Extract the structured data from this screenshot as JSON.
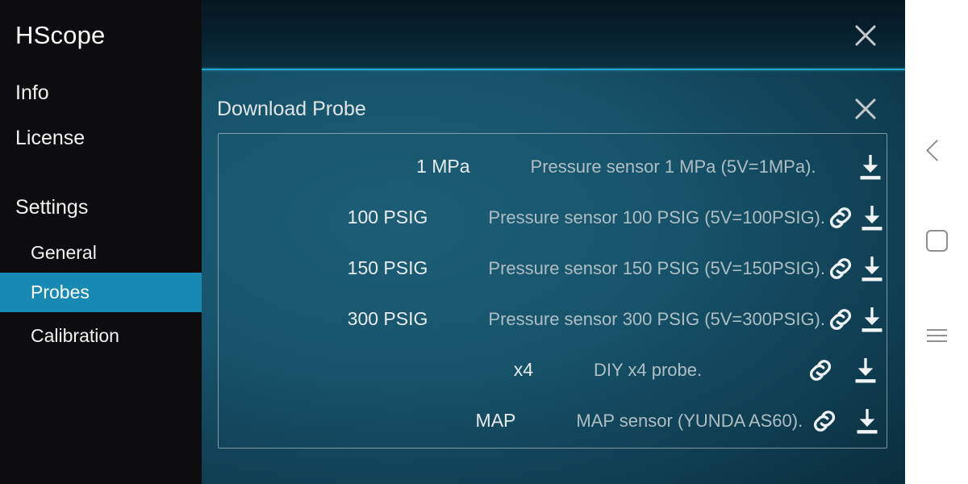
{
  "sidebar": {
    "app_title": "HScope",
    "items": [
      {
        "label": "Info"
      },
      {
        "label": "License"
      },
      {
        "label": "Settings"
      },
      {
        "label": "General"
      },
      {
        "label": "Probes"
      },
      {
        "label": "Calibration"
      }
    ],
    "selected": "Probes",
    "background": "#0d0d0f",
    "accent": "#1789b2"
  },
  "topbar": {
    "close_icon": "close-icon",
    "divider_color": "#23a6cc"
  },
  "dialog": {
    "title": "Download Probe",
    "close_icon": "close-icon"
  },
  "probes": [
    {
      "name": "1 MPa",
      "description": "Pressure sensor 1 MPa (5V=1MPa).",
      "has_link": false,
      "link_icon": "link-icon",
      "download_icon": "download-icon"
    },
    {
      "name": "100 PSIG",
      "description": "Pressure sensor 100 PSIG (5V=100PSIG).",
      "has_link": true,
      "link_icon": "link-icon",
      "download_icon": "download-icon"
    },
    {
      "name": "150 PSIG",
      "description": "Pressure sensor 150 PSIG (5V=150PSIG).",
      "has_link": true,
      "link_icon": "link-icon",
      "download_icon": "download-icon"
    },
    {
      "name": "300 PSIG",
      "description": "Pressure sensor 300 PSIG (5V=300PSIG).",
      "has_link": true,
      "link_icon": "link-icon",
      "download_icon": "download-icon"
    },
    {
      "name": "x4",
      "description": "DIY x4 probe.",
      "has_link": true,
      "link_icon": "link-icon",
      "download_icon": "download-icon"
    },
    {
      "name": "MAP",
      "description": "MAP sensor (YUNDA AS60).",
      "has_link": true,
      "link_icon": "link-icon",
      "download_icon": "download-icon"
    }
  ],
  "navbar": {
    "back_icon": "back-chevron-icon",
    "home_icon": "home-square-icon",
    "recents_icon": "recents-menu-icon"
  }
}
